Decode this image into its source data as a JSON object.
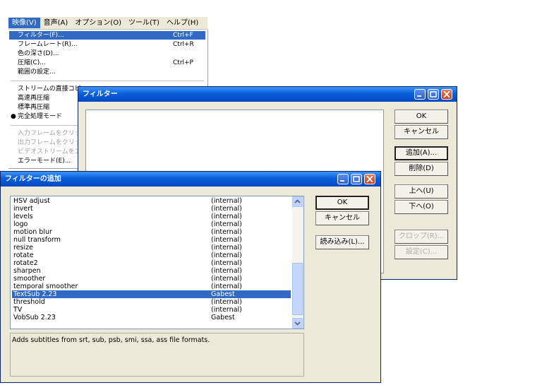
{
  "menubar": {
    "items": [
      "映像(V)",
      "音声(A)",
      "オプション(O)",
      "ツール(T)",
      "ヘルプ(H)"
    ]
  },
  "video_menu": {
    "items": [
      {
        "label": "フィルター(F)...",
        "shortcut": "Ctrl+F"
      },
      {
        "label": "フレームレート(R)...",
        "shortcut": "Ctrl+R"
      },
      {
        "label": "色の深さ(D)...",
        "shortcut": ""
      },
      {
        "label": "圧縮(C)...",
        "shortcut": "Ctrl+P"
      },
      {
        "label": "範囲の設定...",
        "shortcut": ""
      },
      {
        "label": "ストリームの直接コピ",
        "shortcut": ""
      },
      {
        "label": "高速再圧縮",
        "shortcut": ""
      },
      {
        "label": "標準再圧縮",
        "shortcut": ""
      },
      {
        "label": "完全処理モード",
        "shortcut": "",
        "bullet": "●"
      },
      {
        "label": "入力フレームをクリッ",
        "shortcut": ""
      },
      {
        "label": "出力フレームをクリッ",
        "shortcut": ""
      },
      {
        "label": "ビデオストリームをエ",
        "shortcut": ""
      },
      {
        "label": "エラーモード(E)...",
        "shortcut": ""
      }
    ]
  },
  "filters_window": {
    "title": "フィルター",
    "buttons": {
      "ok": "OK",
      "cancel": "キャンセル",
      "add": "追加(A)...",
      "delete": "削除(D)",
      "up": "上へ(U)",
      "down": "下へ(O)",
      "crop": "クロップ(R)...",
      "config": "設定(C)..."
    }
  },
  "add_filter_dialog": {
    "title": "フィルターの追加",
    "filters": [
      {
        "name": "HSV adjust",
        "source": "(internal)"
      },
      {
        "name": "invert",
        "source": "(internal)"
      },
      {
        "name": "levels",
        "source": "(internal)"
      },
      {
        "name": "logo",
        "source": "(internal)"
      },
      {
        "name": "motion blur",
        "source": "(internal)"
      },
      {
        "name": "null transform",
        "source": "(internal)"
      },
      {
        "name": "resize",
        "source": "(internal)"
      },
      {
        "name": "rotate",
        "source": "(internal)"
      },
      {
        "name": "rotate2",
        "source": "(internal)"
      },
      {
        "name": "sharpen",
        "source": "(internal)"
      },
      {
        "name": "smoother",
        "source": "(internal)"
      },
      {
        "name": "temporal smoother",
        "source": "(internal)"
      },
      {
        "name": "TextSub 2.23",
        "source": "Gabest"
      },
      {
        "name": "threshold",
        "source": "(internal)"
      },
      {
        "name": "TV",
        "source": "(internal)"
      },
      {
        "name": "VobSub 2.23",
        "source": "Gabest"
      }
    ],
    "selected_filter": "TextSub 2.23",
    "description": "Adds subtitles from srt, sub, psb, smi, ssa, ass file formats.",
    "buttons": {
      "ok": "OK",
      "cancel": "キャンセル",
      "load": "読み込み(L)..."
    }
  },
  "colors": {
    "selection": "#316ac5",
    "titlebar": "#0a5fd8",
    "dialog_face": "#ece9d8",
    "close_button": "#c8401c"
  }
}
